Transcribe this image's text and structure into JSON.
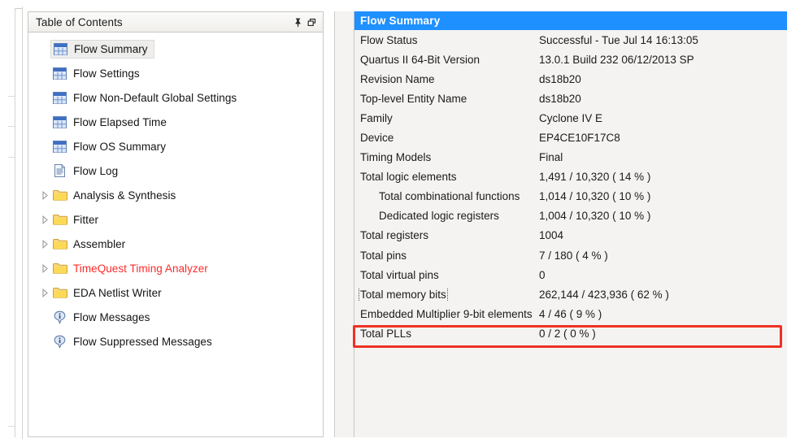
{
  "toc": {
    "title": "Table of Contents",
    "pin_icon": "pushpin-icon",
    "restore_icon": "restore-window-icon",
    "items": [
      {
        "label": "Flow Summary",
        "icon": "table-report-icon",
        "expandable": false,
        "selected": true,
        "alert": false
      },
      {
        "label": "Flow Settings",
        "icon": "table-report-icon",
        "expandable": false,
        "selected": false,
        "alert": false
      },
      {
        "label": "Flow Non-Default Global Settings",
        "icon": "table-report-icon",
        "expandable": false,
        "selected": false,
        "alert": false
      },
      {
        "label": "Flow Elapsed Time",
        "icon": "table-report-icon",
        "expandable": false,
        "selected": false,
        "alert": false
      },
      {
        "label": "Flow OS Summary",
        "icon": "table-report-icon",
        "expandable": false,
        "selected": false,
        "alert": false
      },
      {
        "label": "Flow Log",
        "icon": "document-icon",
        "expandable": false,
        "selected": false,
        "alert": false
      },
      {
        "label": "Analysis & Synthesis",
        "icon": "folder-icon",
        "expandable": true,
        "selected": false,
        "alert": false
      },
      {
        "label": "Fitter",
        "icon": "folder-icon",
        "expandable": true,
        "selected": false,
        "alert": false
      },
      {
        "label": "Assembler",
        "icon": "folder-icon",
        "expandable": true,
        "selected": false,
        "alert": false
      },
      {
        "label": "TimeQuest Timing Analyzer",
        "icon": "folder-icon",
        "expandable": true,
        "selected": false,
        "alert": true
      },
      {
        "label": "EDA Netlist Writer",
        "icon": "folder-icon",
        "expandable": true,
        "selected": false,
        "alert": false
      },
      {
        "label": "Flow Messages",
        "icon": "info-icon",
        "expandable": false,
        "selected": false,
        "alert": false
      },
      {
        "label": "Flow Suppressed Messages",
        "icon": "info-icon",
        "expandable": false,
        "selected": false,
        "alert": false
      }
    ]
  },
  "report": {
    "header": "Flow Summary",
    "rows": [
      {
        "label": "Flow Status",
        "value": "Successful - Tue Jul 14 16:13:05",
        "indent": false,
        "focused": false,
        "highlighted": false
      },
      {
        "label": "Quartus II 64-Bit Version",
        "value": "13.0.1 Build 232 06/12/2013 SP",
        "indent": false,
        "focused": false,
        "highlighted": false
      },
      {
        "label": "Revision Name",
        "value": "ds18b20",
        "indent": false,
        "focused": false,
        "highlighted": false
      },
      {
        "label": "Top-level Entity Name",
        "value": "ds18b20",
        "indent": false,
        "focused": false,
        "highlighted": false
      },
      {
        "label": "Family",
        "value": "Cyclone IV E",
        "indent": false,
        "focused": false,
        "highlighted": false
      },
      {
        "label": "Device",
        "value": "EP4CE10F17C8",
        "indent": false,
        "focused": false,
        "highlighted": false
      },
      {
        "label": "Timing Models",
        "value": "Final",
        "indent": false,
        "focused": false,
        "highlighted": false
      },
      {
        "label": "Total logic elements",
        "value": "1,491 / 10,320 ( 14 % )",
        "indent": false,
        "focused": false,
        "highlighted": false
      },
      {
        "label": "Total combinational functions",
        "value": "1,014 / 10,320 ( 10 % )",
        "indent": true,
        "focused": false,
        "highlighted": false
      },
      {
        "label": "Dedicated logic registers",
        "value": "1,004 / 10,320 ( 10 % )",
        "indent": true,
        "focused": false,
        "highlighted": false
      },
      {
        "label": "Total registers",
        "value": "1004",
        "indent": false,
        "focused": false,
        "highlighted": false
      },
      {
        "label": "Total pins",
        "value": "7 / 180 ( 4 % )",
        "indent": false,
        "focused": false,
        "highlighted": false
      },
      {
        "label": "Total virtual pins",
        "value": "0",
        "indent": false,
        "focused": false,
        "highlighted": false
      },
      {
        "label": "Total memory bits",
        "value": "262,144 / 423,936 ( 62 % )",
        "indent": false,
        "focused": true,
        "highlighted": true
      },
      {
        "label": "Embedded Multiplier 9-bit elements",
        "value": "4 / 46 ( 9 % )",
        "indent": false,
        "focused": false,
        "highlighted": false
      },
      {
        "label": "Total PLLs",
        "value": "0 / 2 ( 0 % )",
        "indent": false,
        "focused": false,
        "highlighted": false
      }
    ]
  },
  "annotation": {
    "name": "red-highlight-box",
    "target_row": "Total memory bits",
    "color": "#ee3124"
  },
  "colors": {
    "header_blue": "#1e90ff",
    "alert_red": "#fb2b2b",
    "panel_bg": "#f4f3f1",
    "annotation_red": "#ee3124"
  }
}
